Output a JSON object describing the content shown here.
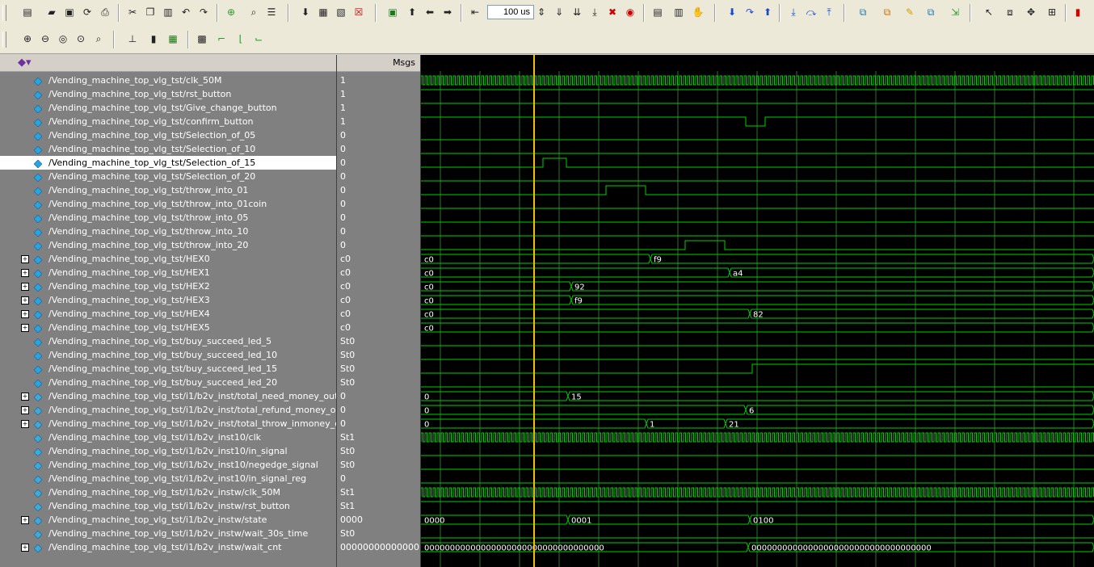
{
  "toolbar": {
    "time_step_value": "100 us",
    "icons_row1": [
      "new-icon",
      "open-icon",
      "save-icon",
      "reload-icon",
      "print-icon",
      "cut-icon",
      "copy-icon",
      "paste-icon",
      "undo-icon",
      "redo-icon",
      "add-icon",
      "find-icon",
      "format-icon",
      "compile-icon",
      "compile-all-icon",
      "simulate-icon",
      "break-icon",
      "zoom-box-icon",
      "up-icon",
      "left-icon",
      "right-icon",
      "restart-icon",
      "run-icon",
      "continue-icon",
      "run-all-icon",
      "stop-icon",
      "step-icon",
      "step-over-icon",
      "step-out-icon",
      "hand-icon",
      "step-into-icon",
      "step-back-icon",
      "step-return-icon",
      "step-a-icon",
      "step-b-icon",
      "step-c-icon",
      "wave-add-icon",
      "wave-insert-icon",
      "wave-edit-icon",
      "wave-group-icon",
      "wave-export-icon",
      "select-icon",
      "zoom-mode-icon",
      "pan-icon",
      "cursor-icon",
      "dataflow-icon"
    ],
    "icons_row2": [
      "zoom-in-icon",
      "zoom-out-icon",
      "zoom-full-icon",
      "zoom-cursor-icon",
      "zoom-region-icon",
      "cursor-add-icon",
      "cursor-lock-icon",
      "cursor-delete-icon",
      "edge-prev-icon",
      "edge-next-icon",
      "edge-fall-icon"
    ]
  },
  "headers": {
    "values": "Msgs"
  },
  "signals": [
    {
      "name": "/Vending_machine_top_vlg_tst/clk_50M",
      "value": "1",
      "expand": false,
      "kind": "clk"
    },
    {
      "name": "/Vending_machine_top_vlg_tst/rst_button",
      "value": "1",
      "expand": false,
      "kind": "bit"
    },
    {
      "name": "/Vending_machine_top_vlg_tst/Give_change_button",
      "value": "1",
      "expand": false,
      "kind": "bit"
    },
    {
      "name": "/Vending_machine_top_vlg_tst/confirm_button",
      "value": "1",
      "expand": false,
      "kind": "bit"
    },
    {
      "name": "/Vending_machine_top_vlg_tst/Selection_of_05",
      "value": "0",
      "expand": false,
      "kind": "bit"
    },
    {
      "name": "/Vending_machine_top_vlg_tst/Selection_of_10",
      "value": "0",
      "expand": false,
      "kind": "bit"
    },
    {
      "name": "/Vending_machine_top_vlg_tst/Selection_of_15",
      "value": "0",
      "expand": false,
      "kind": "bit",
      "selected": true
    },
    {
      "name": "/Vending_machine_top_vlg_tst/Selection_of_20",
      "value": "0",
      "expand": false,
      "kind": "bit"
    },
    {
      "name": "/Vending_machine_top_vlg_tst/throw_into_01",
      "value": "0",
      "expand": false,
      "kind": "bit"
    },
    {
      "name": "/Vending_machine_top_vlg_tst/throw_into_01coin",
      "value": "0",
      "expand": false,
      "kind": "bit"
    },
    {
      "name": "/Vending_machine_top_vlg_tst/throw_into_05",
      "value": "0",
      "expand": false,
      "kind": "bit"
    },
    {
      "name": "/Vending_machine_top_vlg_tst/throw_into_10",
      "value": "0",
      "expand": false,
      "kind": "bit"
    },
    {
      "name": "/Vending_machine_top_vlg_tst/throw_into_20",
      "value": "0",
      "expand": false,
      "kind": "bit"
    },
    {
      "name": "/Vending_machine_top_vlg_tst/HEX0",
      "value": "c0",
      "expand": true,
      "kind": "bus"
    },
    {
      "name": "/Vending_machine_top_vlg_tst/HEX1",
      "value": "c0",
      "expand": true,
      "kind": "bus"
    },
    {
      "name": "/Vending_machine_top_vlg_tst/HEX2",
      "value": "c0",
      "expand": true,
      "kind": "bus"
    },
    {
      "name": "/Vending_machine_top_vlg_tst/HEX3",
      "value": "c0",
      "expand": true,
      "kind": "bus"
    },
    {
      "name": "/Vending_machine_top_vlg_tst/HEX4",
      "value": "c0",
      "expand": true,
      "kind": "bus"
    },
    {
      "name": "/Vending_machine_top_vlg_tst/HEX5",
      "value": "c0",
      "expand": true,
      "kind": "bus"
    },
    {
      "name": "/Vending_machine_top_vlg_tst/buy_succeed_led_5",
      "value": "St0",
      "expand": false,
      "kind": "bit"
    },
    {
      "name": "/Vending_machine_top_vlg_tst/buy_succeed_led_10",
      "value": "St0",
      "expand": false,
      "kind": "bit"
    },
    {
      "name": "/Vending_machine_top_vlg_tst/buy_succeed_led_15",
      "value": "St0",
      "expand": false,
      "kind": "bit"
    },
    {
      "name": "/Vending_machine_top_vlg_tst/buy_succeed_led_20",
      "value": "St0",
      "expand": false,
      "kind": "bit"
    },
    {
      "name": "/Vending_machine_top_vlg_tst/i1/b2v_inst/total_need_money_out",
      "value": "0",
      "expand": true,
      "kind": "bus"
    },
    {
      "name": "/Vending_machine_top_vlg_tst/i1/b2v_inst/total_refund_money_out",
      "value": "0",
      "expand": true,
      "kind": "bus"
    },
    {
      "name": "/Vending_machine_top_vlg_tst/i1/b2v_inst/total_throw_inmoney_out",
      "value": "0",
      "expand": true,
      "kind": "bus"
    },
    {
      "name": "/Vending_machine_top_vlg_tst/i1/b2v_inst10/clk",
      "value": "St1",
      "expand": false,
      "kind": "clk"
    },
    {
      "name": "/Vending_machine_top_vlg_tst/i1/b2v_inst10/in_signal",
      "value": "St0",
      "expand": false,
      "kind": "bit"
    },
    {
      "name": "/Vending_machine_top_vlg_tst/i1/b2v_inst10/negedge_signal",
      "value": "St0",
      "expand": false,
      "kind": "bit"
    },
    {
      "name": "/Vending_machine_top_vlg_tst/i1/b2v_inst10/in_signal_reg",
      "value": "0",
      "expand": false,
      "kind": "bit"
    },
    {
      "name": "/Vending_machine_top_vlg_tst/i1/b2v_instw/clk_50M",
      "value": "St1",
      "expand": false,
      "kind": "clk"
    },
    {
      "name": "/Vending_machine_top_vlg_tst/i1/b2v_instw/rst_button",
      "value": "St1",
      "expand": false,
      "kind": "bit"
    },
    {
      "name": "/Vending_machine_top_vlg_tst/i1/b2v_instw/state",
      "value": "0000",
      "expand": true,
      "kind": "bus"
    },
    {
      "name": "/Vending_machine_top_vlg_tst/i1/b2v_instw/wait_30s_time",
      "value": "St0",
      "expand": false,
      "kind": "bit"
    },
    {
      "name": "/Vending_machine_top_vlg_tst/i1/b2v_instw/wait_cnt",
      "value": "00000000000000...",
      "expand": true,
      "kind": "bus"
    }
  ],
  "waves": {
    "colors": {
      "wave": "#00d000",
      "grid": "#2f6f2f",
      "cursor": "#f0c000",
      "text": "#ffffff"
    },
    "bits": {
      "3": {
        "init": 1,
        "toggles": [
          402,
          426
        ]
      },
      "6": {
        "init": 0,
        "toggles": [
          151,
          180
        ]
      },
      "8": {
        "init": 0,
        "toggles": [
          229,
          278
        ]
      },
      "12": {
        "init": 0,
        "toggles": [
          327,
          376
        ]
      },
      "21": {
        "init": 0,
        "toggles": [
          410
        ]
      }
    },
    "buses": {
      "13": [
        [
          "c0",
          0
        ],
        [
          "f9",
          284
        ]
      ],
      "14": [
        [
          "c0",
          0
        ],
        [
          "a4",
          382
        ]
      ],
      "15": [
        [
          "c0",
          0
        ],
        [
          "92",
          186
        ]
      ],
      "16": [
        [
          "c0",
          0
        ],
        [
          "f9",
          186
        ]
      ],
      "17": [
        [
          "c0",
          0
        ],
        [
          "82",
          407
        ]
      ],
      "18": [
        [
          "c0",
          0
        ]
      ],
      "23": [
        [
          "0",
          0
        ],
        [
          "15",
          182
        ]
      ],
      "24": [
        [
          "0",
          0
        ],
        [
          "6",
          402
        ]
      ],
      "25": [
        [
          "0",
          0
        ],
        [
          "1",
          279
        ],
        [
          "21",
          377
        ]
      ],
      "32": [
        [
          "0000",
          0
        ],
        [
          "0001",
          182
        ],
        [
          "0100",
          407
        ]
      ],
      "34": [
        [
          "00000000000000000000000000000000000",
          0
        ],
        [
          "00000000000000000000000000000000000",
          405
        ]
      ]
    }
  }
}
